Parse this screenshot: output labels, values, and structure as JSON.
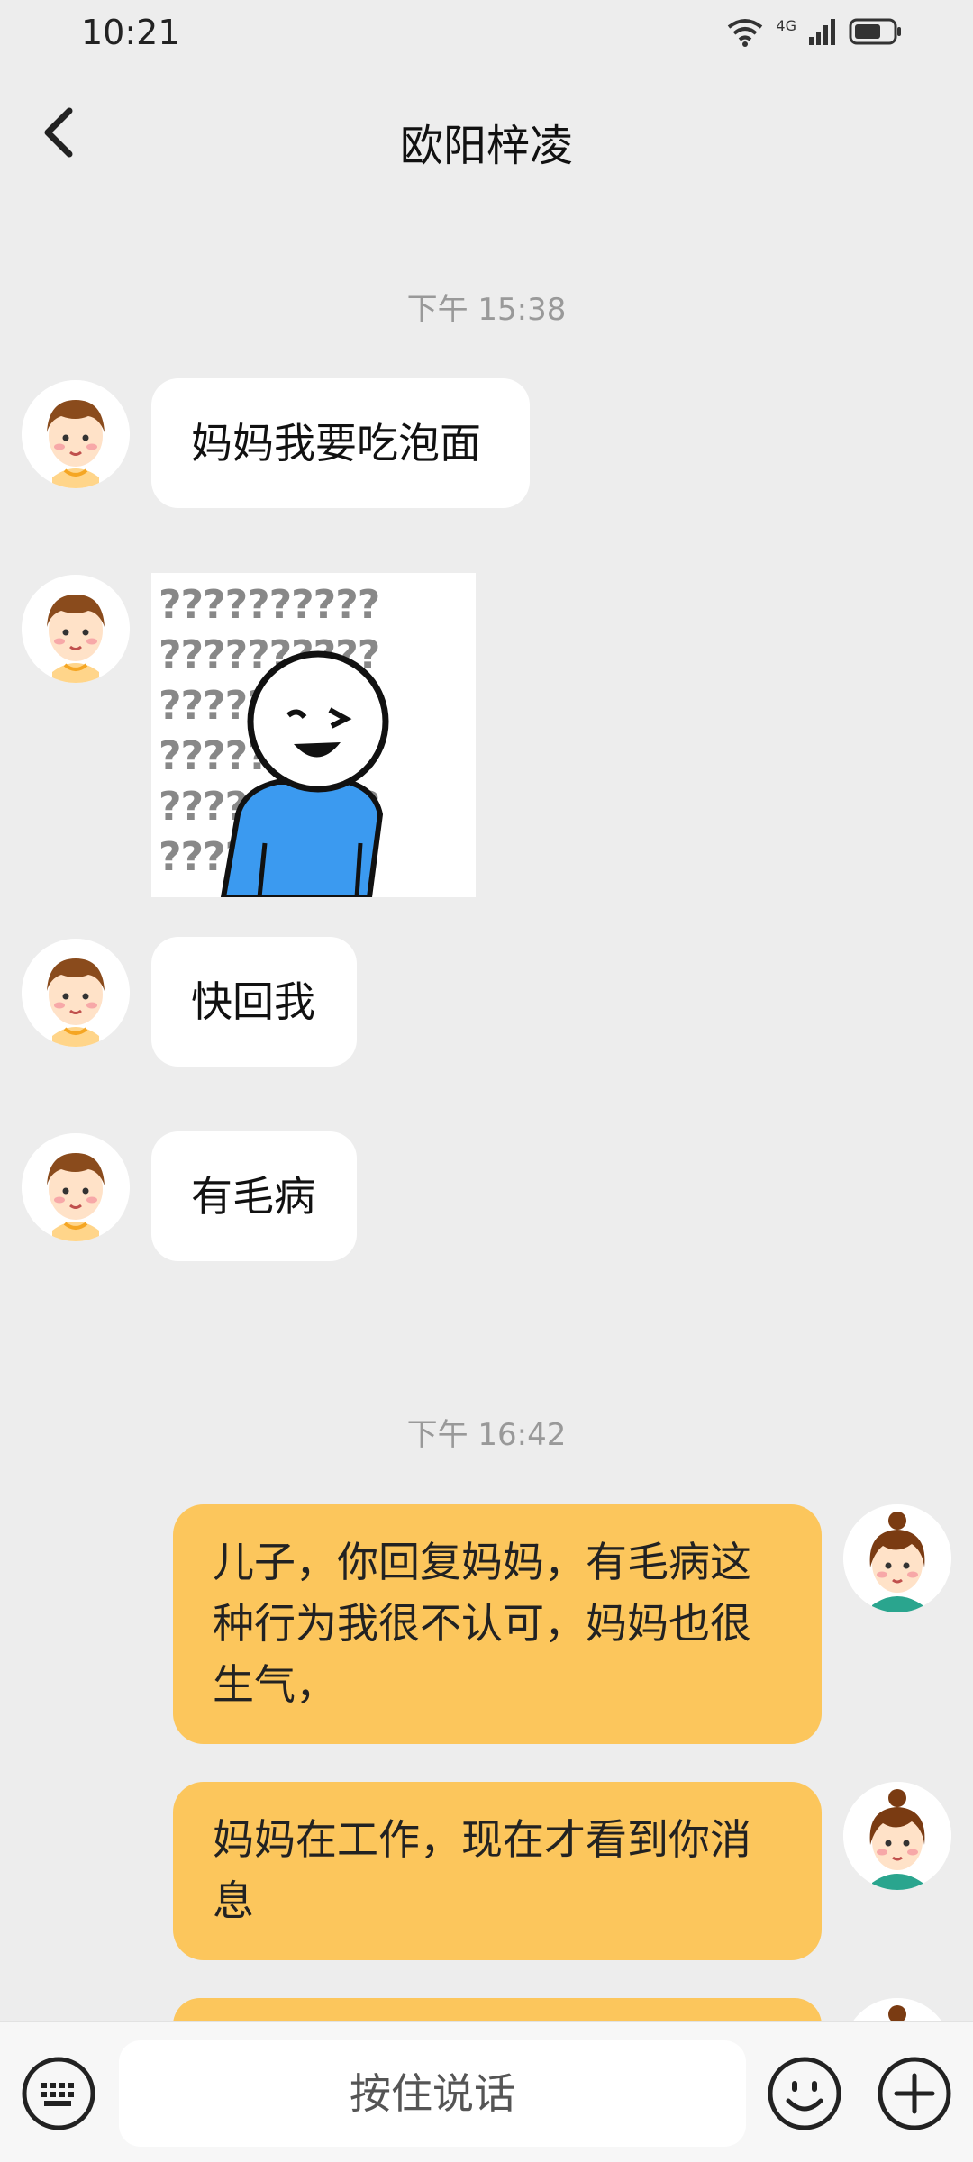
{
  "status": {
    "time": "10:21",
    "network": "4G"
  },
  "header": {
    "title": "欧阳梓凌"
  },
  "timestamps": [
    "下午 15:38",
    "下午 16:42"
  ],
  "messages": [
    {
      "side": "in",
      "text": "妈妈我要吃泡面"
    },
    {
      "side": "in",
      "type": "sticker",
      "sticker_text": "??????????"
    },
    {
      "side": "in",
      "text": "快回我"
    },
    {
      "side": "in",
      "text": "有毛病"
    },
    {
      "side": "out",
      "text": "儿子，你回复妈妈，有毛病这种行为我很不认可，妈妈也很生气，"
    },
    {
      "side": "out",
      "text": "妈妈在工作，现在才看到你消息"
    }
  ],
  "input": {
    "voice_label": "按住说话"
  },
  "icons": {
    "back": "chevron-left-icon",
    "keyboard": "keyboard-icon",
    "emoji": "emoji-icon",
    "add": "plus-circle-icon"
  },
  "colors": {
    "outgoing_bubble": "#fcc65c",
    "incoming_bubble": "#ffffff",
    "background": "#ededed"
  }
}
